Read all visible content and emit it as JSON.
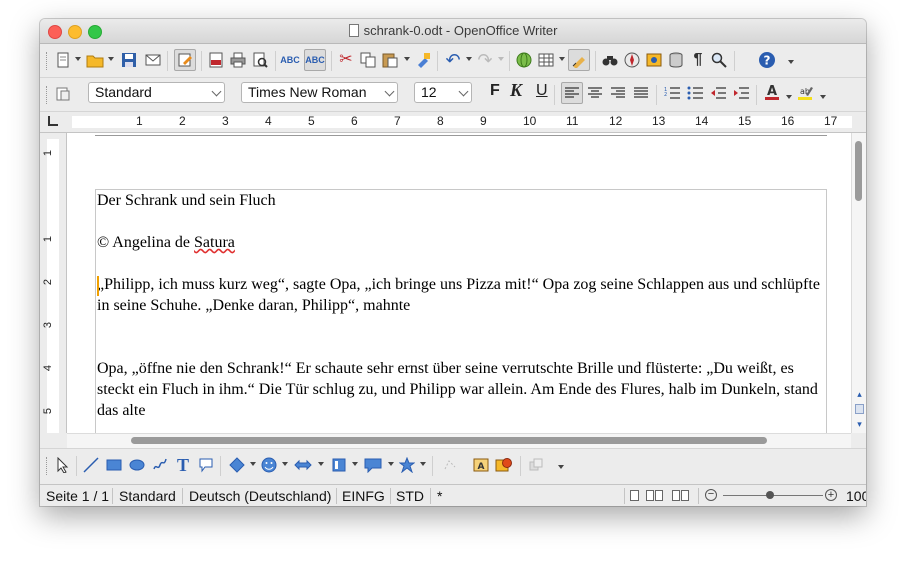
{
  "window": {
    "title": "schrank-0.odt - OpenOffice Writer"
  },
  "toolbar_standard": {
    "icons": [
      "new-document-icon",
      "open-icon",
      "save-icon",
      "email-icon",
      "edit-mode-icon",
      "export-pdf-icon",
      "print-icon",
      "print-preview-icon",
      "spellcheck-icon",
      "autospellcheck-icon",
      "cut-icon",
      "copy-icon",
      "paste-icon",
      "format-paintbrush-icon",
      "undo-icon",
      "redo-icon",
      "hyperlink-icon",
      "table-icon",
      "draw-functions-icon",
      "find-replace-icon",
      "navigator-icon",
      "gallery-icon",
      "data-sources-icon",
      "formatting-marks-icon",
      "zoom-icon",
      "help-icon"
    ]
  },
  "toolbar_formatting": {
    "style_value": "Standard",
    "font_value": "Times New Roman",
    "size_value": "12",
    "bold_label": "F",
    "italic_label": "K",
    "underline_label": "U",
    "highlight_label": "ab"
  },
  "ruler": {
    "numbers": [
      "1",
      "2",
      "3",
      "4",
      "5",
      "6",
      "7",
      "8",
      "9",
      "10",
      "11",
      "12",
      "13",
      "14",
      "15",
      "16",
      "17"
    ],
    "vertical_numbers": [
      "1",
      "1",
      "2",
      "3",
      "4",
      "5"
    ]
  },
  "document": {
    "paragraphs": [
      {
        "text": "Der Schrank und sein Fluch"
      },
      {
        "prefix": "© Angelina de ",
        "misspelled": "Satura",
        "suffix": ""
      },
      {
        "text": "„Philipp, ich muss kurz weg“, sagte Opa, „ich bringe uns Pizza mit!“ Opa zog seine Schlappen aus und schlüpfte in seine Schuhe. „Denke daran, Philipp“, mahnte"
      },
      {
        "text": "Opa, „öffne nie den Schrank!“ Er schaute sehr ernst über seine verrutschte Brille und flüsterte: „Du weißt, es steckt ein Fluch in ihm.“ Die Tür schlug zu, und Philipp war allein. Am Ende des Flures, halb im Dunkeln, stand das alte"
      }
    ]
  },
  "statusbar": {
    "page": "Seite 1 / 1",
    "style": "Standard",
    "language": "Deutsch (Deutschland)",
    "insert_mode": "EINFG",
    "selection_mode": "STD",
    "modified": "*",
    "zoom": "100"
  },
  "colors": {
    "accent_close": "#fc5f57",
    "accent_minimize": "#fdbc2e",
    "accent_maximize": "#33c748",
    "cursor": "#f0a000",
    "spell_underline": "#e03030"
  }
}
